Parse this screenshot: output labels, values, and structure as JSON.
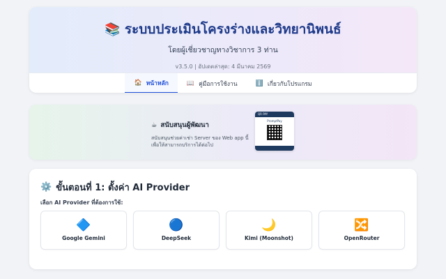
{
  "header": {
    "title_icon": "📚",
    "title": "ระบบประเมินโครงร่างและวิทยานิพนธ์",
    "subtitle": "โดยผู้เชี่ยวชาญทางวิชาการ 3 ท่าน",
    "version": "v3.5.0 | อัปเดตล่าสุด: 4 มีนาคม 2569"
  },
  "nav": {
    "items": [
      {
        "icon": "🏠",
        "label": "หน้าหลัก"
      },
      {
        "icon": "📖",
        "label": "คู่มือการใช้งาน"
      },
      {
        "icon": "ℹ️",
        "label": "เกี่ยวกับโปรแกรม"
      }
    ]
  },
  "support": {
    "icon": "☕",
    "title": "สนับสนุนผู้พัฒนา",
    "line1": "สนับสนุนช่วยค่าเช่า Server ของ Web app นี้",
    "line2": "เพื่อให้สามารถบริการได้ต่อไป",
    "qr_header": "QR PAY",
    "qr_label": "PromptPay"
  },
  "step1": {
    "icon": "⚙️",
    "title": "ขั้นตอนที่ 1: ตั้งค่า AI Provider",
    "label": "เลือก AI Provider ที่ต้องการใช้:",
    "providers": [
      {
        "icon": "🔷",
        "name": "Google Gemini"
      },
      {
        "icon": "🔵",
        "name": "DeepSeek"
      },
      {
        "icon": "🌙",
        "name": "Kimi (Moonshot)"
      },
      {
        "icon": "🔀",
        "name": "OpenRouter"
      }
    ]
  }
}
